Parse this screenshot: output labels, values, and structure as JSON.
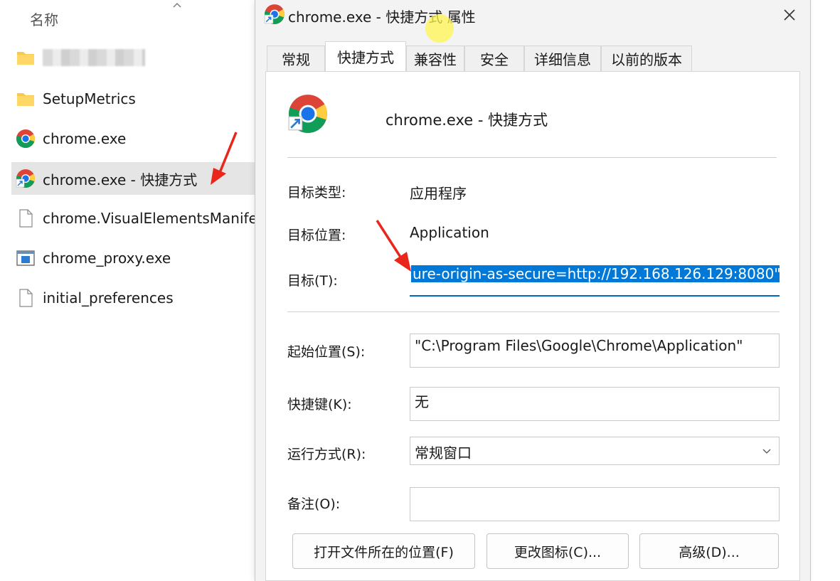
{
  "explorer": {
    "column_header": "名称",
    "files": [
      {
        "label": "",
        "icon": "folder-icon",
        "blurred": true
      },
      {
        "label": "SetupMetrics",
        "icon": "folder-icon"
      },
      {
        "label": "chrome.exe",
        "icon": "chrome-icon"
      },
      {
        "label": "chrome.exe - 快捷方式",
        "icon": "chrome-shortcut-icon",
        "selected": true
      },
      {
        "label": "chrome.VisualElementsManifest.xml",
        "icon": "document-icon"
      },
      {
        "label": "chrome_proxy.exe",
        "icon": "app-window-icon"
      },
      {
        "label": "initial_preferences",
        "icon": "document-icon"
      }
    ]
  },
  "dialog": {
    "title": "chrome.exe - 快捷方式 属性",
    "tabs": [
      "常规",
      "快捷方式",
      "兼容性",
      "安全",
      "详细信息",
      "以前的版本"
    ],
    "active_tab": "快捷方式",
    "shortcut_name": "chrome.exe - 快捷方式",
    "fields": {
      "target_type_label": "目标类型:",
      "target_type_value": "应用程序",
      "target_location_label": "目标位置:",
      "target_location_value": "Application",
      "target_label": "目标(T):",
      "target_value": "ure-origin-as-secure=http://192.168.126.129:8080\"",
      "start_in_label": "起始位置(S):",
      "start_in_value": "\"C:\\Program Files\\Google\\Chrome\\Application\"",
      "hotkey_label": "快捷键(K):",
      "hotkey_value": "无",
      "run_label": "运行方式(R):",
      "run_value": "常规窗口",
      "comment_label": "备注(O):",
      "comment_value": ""
    },
    "buttons": {
      "open_location": "打开文件所在的位置(F)",
      "change_icon": "更改图标(C)...",
      "advanced": "高级(D)..."
    }
  },
  "colors": {
    "selection": "#0078d7",
    "annotation_arrow": "#e8261c",
    "cursor_highlight": "#fff550"
  }
}
